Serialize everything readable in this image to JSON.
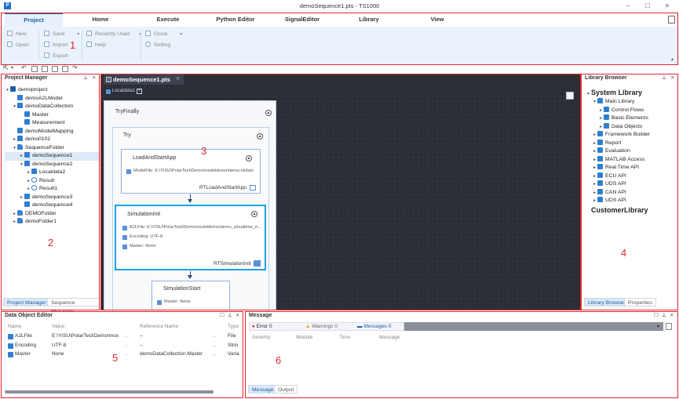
{
  "window": {
    "title": "demoSequence1.pts - TS1000",
    "app_icon": "P"
  },
  "ribbon": {
    "tabs": [
      "Project",
      "Home",
      "Execute",
      "Python Editor",
      "SignalEditor",
      "Library",
      "View"
    ],
    "groups": {
      "new": "New",
      "open": "Open",
      "save": "Save",
      "import": "Import",
      "export": "Export",
      "recently_used": "Recently Used",
      "help": "Help",
      "close": "Close",
      "setting": "Setting"
    }
  },
  "annotations": [
    "1",
    "2",
    "3",
    "4",
    "5",
    "6"
  ],
  "project_manager": {
    "title": "Project Manager",
    "tree": [
      {
        "label": "demoproject",
        "level": 0,
        "caret": "▾",
        "icon": "project"
      },
      {
        "label": "demoA2LModel",
        "level": 1,
        "caret": "",
        "icon": "model"
      },
      {
        "label": "demoDataCollection",
        "level": 1,
        "caret": "▾",
        "icon": "data"
      },
      {
        "label": "Master",
        "level": 2,
        "caret": "",
        "icon": "m"
      },
      {
        "label": "Measurement",
        "level": 2,
        "caret": "",
        "icon": "m"
      },
      {
        "label": "demoModelMapping",
        "level": 1,
        "caret": "",
        "icon": "map"
      },
      {
        "label": "demo0102",
        "level": 1,
        "caret": "▸",
        "icon": "seq"
      },
      {
        "label": "SequenceFolder",
        "level": 1,
        "caret": "▾",
        "icon": "folder"
      },
      {
        "label": "demoSequence1",
        "level": 2,
        "caret": "▸",
        "icon": "seq",
        "selected": true
      },
      {
        "label": "demoSequence2",
        "level": 2,
        "caret": "▾",
        "icon": "seq"
      },
      {
        "label": "Localdata2",
        "level": 3,
        "caret": "▸",
        "icon": "data"
      },
      {
        "label": "Result",
        "level": 3,
        "caret": "▸",
        "icon": "result"
      },
      {
        "label": "Result1",
        "level": 3,
        "caret": "▸",
        "icon": "result"
      },
      {
        "label": "demoSequence3",
        "level": 2,
        "caret": "▸",
        "icon": "seq"
      },
      {
        "label": "demoSequence4",
        "level": 2,
        "caret": "",
        "icon": "seq"
      },
      {
        "label": "DEMOFolder",
        "level": 1,
        "caret": "▸",
        "icon": "folder"
      },
      {
        "label": "demoFolder1",
        "level": 1,
        "caret": "▸",
        "icon": "folder"
      }
    ],
    "bottom_tabs": [
      "Project Manager",
      "Sequence Hierarchy"
    ]
  },
  "editor": {
    "tab": "demoSequence1.pts",
    "localdata": "Localdata1",
    "tryfinally": "TryFinally",
    "try": "Try",
    "load": {
      "title": "LoadAndStartApp",
      "line": "ModelFile: E:\\YISU\\PolarTest\\Demo\\modeldemo\\demo.mldatx",
      "footer": "RTLoadAndStartApp"
    },
    "sim_init": {
      "title": "SimulationInit",
      "lines": [
        "A2LFile: E:\\YISU\\PolarTest\\Demo\\modeldemo\\demo_slrealtime_rt...",
        "Encoding: UTF-8",
        "Master: None"
      ],
      "footer": "RTSimulationInit"
    },
    "sim_start": {
      "title": "SimulationStart",
      "line": "Master: None"
    }
  },
  "library_browser": {
    "title": "Library Browser",
    "tree": [
      {
        "label": "System Library",
        "level": 0,
        "caret": "▾",
        "big": true
      },
      {
        "label": "Main Library",
        "level": 1,
        "caret": "▾",
        "icon": "lib"
      },
      {
        "label": "Control Flows",
        "level": 2,
        "caret": "▸",
        "icon": "lib"
      },
      {
        "label": "Basic Elements",
        "level": 2,
        "caret": "▸",
        "icon": "lib"
      },
      {
        "label": "Data Objects",
        "level": 2,
        "caret": "▸",
        "icon": "lib"
      },
      {
        "label": "Framework Builder",
        "level": 1,
        "caret": "▸",
        "icon": "lib"
      },
      {
        "label": "Report",
        "level": 1,
        "caret": "▸",
        "icon": "lib"
      },
      {
        "label": "Evaluation",
        "level": 1,
        "caret": "▸",
        "icon": "lib"
      },
      {
        "label": "MATLAB Access",
        "level": 1,
        "caret": "▸",
        "icon": "lib"
      },
      {
        "label": "Real Time API",
        "level": 1,
        "caret": "▸",
        "icon": "lib"
      },
      {
        "label": "ECU API",
        "level": 1,
        "caret": "▸",
        "icon": "lib"
      },
      {
        "label": "UDS API",
        "level": 1,
        "caret": "▸",
        "icon": "lib"
      },
      {
        "label": "CAN API",
        "level": 1,
        "caret": "▸",
        "icon": "lib"
      },
      {
        "label": "UDS API",
        "level": 1,
        "caret": "▸",
        "icon": "lib"
      },
      {
        "label": "CustomerLibrary",
        "level": 0,
        "caret": "",
        "big": true
      }
    ],
    "bottom_tabs": [
      "Library Browser",
      "Properties"
    ]
  },
  "data_object_editor": {
    "title": "Data Object Editor",
    "columns": [
      "Name",
      "Value",
      "Reference Name",
      "Type"
    ],
    "rows": [
      {
        "name": "A2LFile",
        "value": "E:\\YISU\\PolarTest\\Demo\\mox",
        "ellipsis": "...",
        "ref": "--",
        "type": "File"
      },
      {
        "name": "Encoding",
        "value": "UTF-8",
        "ellipsis": "...",
        "ref": "--",
        "type": "Strin"
      },
      {
        "name": "Master",
        "value": "None",
        "ellipsis": "...",
        "ref": "demoDataCollection.Master",
        "type": "Varia"
      }
    ]
  },
  "message": {
    "title": "Message",
    "filters": {
      "error": "Error 0",
      "warnings": "Warnings 0",
      "messages": "Messages 0"
    },
    "columns": [
      "Severity",
      "Module",
      "Time",
      "Message"
    ],
    "bottom_tabs": [
      "Message",
      "Output"
    ]
  }
}
